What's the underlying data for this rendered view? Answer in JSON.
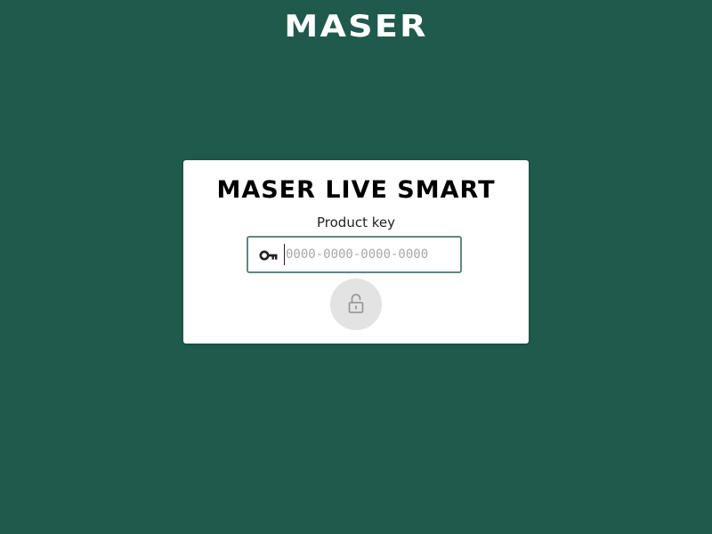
{
  "header": {
    "brand": "MASER"
  },
  "card": {
    "title": "MASER LIVE SMART",
    "field_label": "Product key",
    "input": {
      "placeholder": "0000-0000-0000-0000",
      "value": "",
      "icon": "key-icon"
    },
    "unlock_button": {
      "icon": "unlock-icon",
      "enabled": false
    }
  },
  "colors": {
    "background": "#205a4d",
    "card": "#ffffff",
    "input_border": "#5e8a80",
    "button_disabled": "#e3e3e3"
  }
}
